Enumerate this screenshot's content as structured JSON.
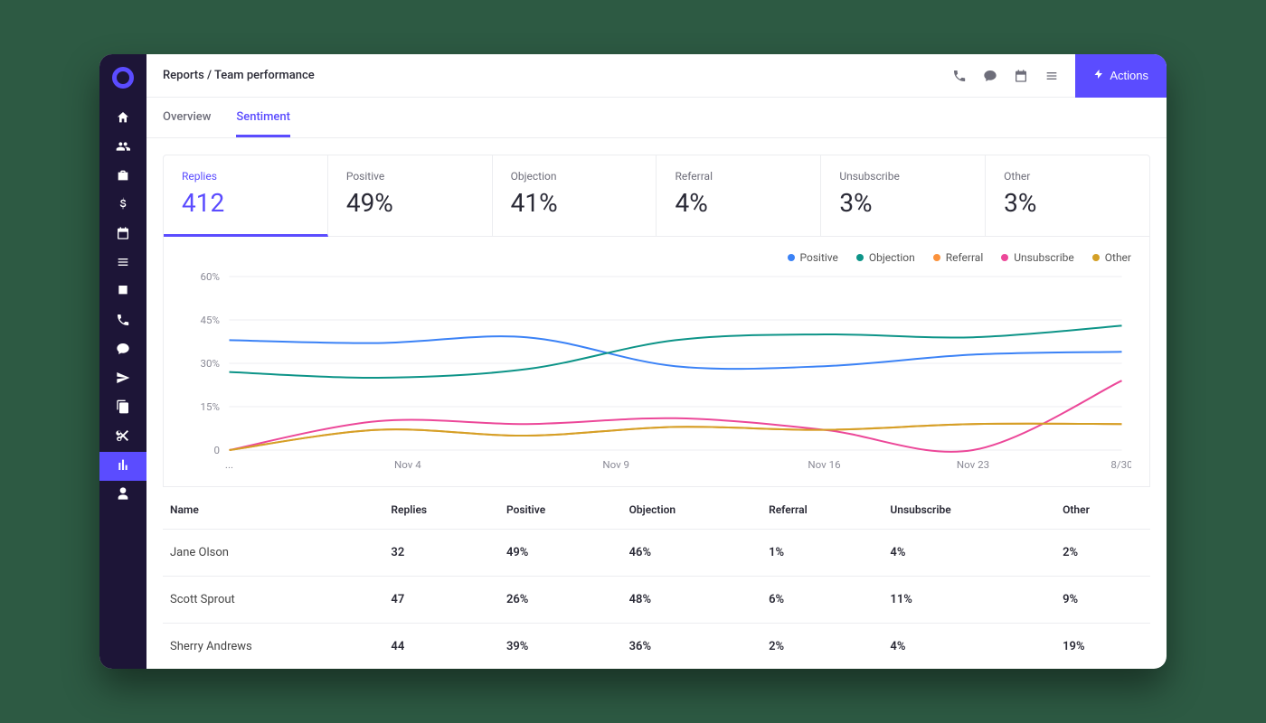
{
  "breadcrumb": "Reports / Team performance",
  "actions_label": "Actions",
  "tabs": [
    {
      "label": "Overview",
      "active": false
    },
    {
      "label": "Sentiment",
      "active": true
    }
  ],
  "stats": [
    {
      "label": "Replies",
      "value": "412",
      "active": true
    },
    {
      "label": "Positive",
      "value": "49%",
      "active": false
    },
    {
      "label": "Objection",
      "value": "41%",
      "active": false
    },
    {
      "label": "Referral",
      "value": "4%",
      "active": false
    },
    {
      "label": "Unsubscribe",
      "value": "3%",
      "active": false
    },
    {
      "label": "Other",
      "value": "3%",
      "active": false
    }
  ],
  "chart_data": {
    "type": "line",
    "ylabel": "",
    "ylim": [
      0,
      60
    ],
    "y_ticks": [
      0,
      15,
      30,
      45,
      60
    ],
    "y_tick_labels": [
      "0",
      "15%",
      "30%",
      "45%",
      "60%"
    ],
    "categories": [
      "...",
      "Nov 4",
      "Nov 9",
      "Nov 16",
      "Nov 23",
      "8/30"
    ],
    "series": [
      {
        "name": "Positive",
        "color": "#3b82f6",
        "values": [
          38,
          37,
          39,
          29,
          29,
          33,
          34
        ]
      },
      {
        "name": "Objection",
        "color": "#0d9488",
        "values": [
          27,
          25,
          28,
          38,
          40,
          39,
          43
        ]
      },
      {
        "name": "Referral",
        "color": "#fb923c",
        "values": [
          0,
          7,
          5,
          8,
          7,
          9,
          9
        ]
      },
      {
        "name": "Unsubscribe",
        "color": "#ec4899",
        "values": [
          0,
          10,
          9,
          11,
          7,
          0,
          24
        ]
      },
      {
        "name": "Other",
        "color": "#d4a026",
        "values": [
          0,
          7,
          5,
          8,
          7,
          9,
          9
        ]
      }
    ]
  },
  "table": {
    "headers": [
      "Name",
      "Replies",
      "Positive",
      "Objection",
      "Referral",
      "Unsubscribe",
      "Other"
    ],
    "rows": [
      [
        "Jane Olson",
        "32",
        "49%",
        "46%",
        "1%",
        "4%",
        "2%"
      ],
      [
        "Scott Sprout",
        "47",
        "26%",
        "48%",
        "6%",
        "11%",
        "9%"
      ],
      [
        "Sherry Andrews",
        "44",
        "39%",
        "36%",
        "2%",
        "4%",
        "19%"
      ]
    ]
  },
  "nav_icons": [
    "home",
    "users",
    "briefcase",
    "dollar",
    "calendar",
    "list",
    "download",
    "phone",
    "chat",
    "send",
    "copy",
    "scissors",
    "bar-chart",
    "user"
  ],
  "nav_active_index": 12,
  "topbar_icons": [
    "phone",
    "chat",
    "calendar",
    "list"
  ],
  "colors": {
    "accent": "#5b4cff",
    "sidebar": "#1d1537"
  }
}
